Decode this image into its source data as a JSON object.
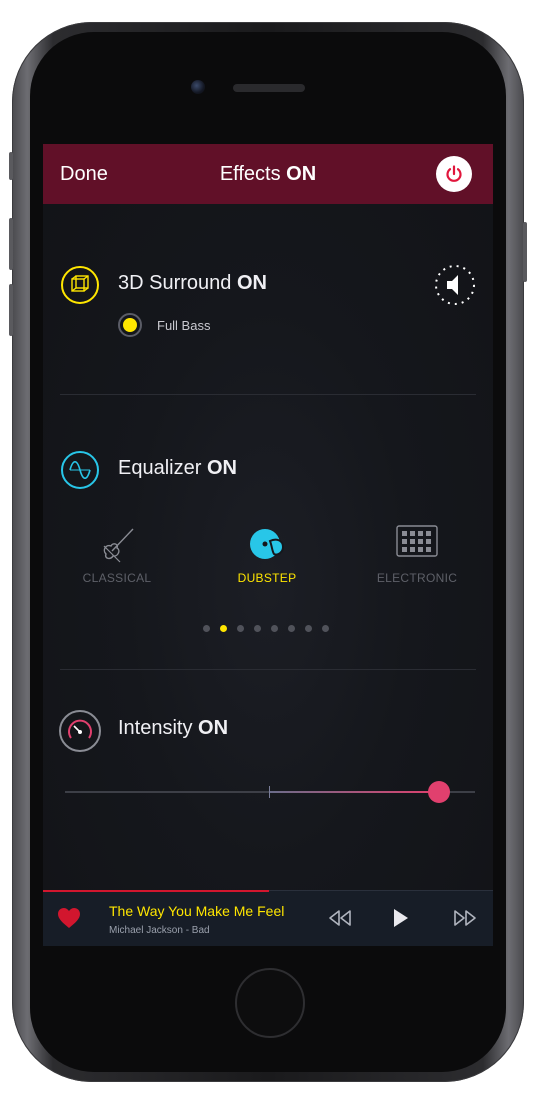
{
  "header": {
    "done_label": "Done",
    "title_prefix": "Effects ",
    "title_state": "ON"
  },
  "surround": {
    "label": "3D Surround ",
    "state": "ON",
    "option_label": "Full Bass"
  },
  "equalizer": {
    "label": "Equalizer ",
    "state": "ON",
    "presets": [
      {
        "label": "CLASSICAL",
        "active": false
      },
      {
        "label": "DUBSTEP",
        "active": true
      },
      {
        "label": "ELECTRONIC",
        "active": false
      }
    ],
    "page_count": 8,
    "active_page": 2
  },
  "intensity": {
    "label": "Intensity ",
    "state": "ON",
    "level": 0.91
  },
  "player": {
    "song_title": "The Way You Make Me Feel",
    "artist_album": "Michael Jackson - Bad",
    "progress": 0.5
  },
  "colors": {
    "header_bg": "#611028",
    "accent_yellow": "#ffe600",
    "accent_cyan": "#28c6e8",
    "accent_pink": "#e1406e",
    "heart_red": "#d2162e"
  },
  "icons": {
    "power": "power-icon",
    "surround": "cube-icon",
    "speaker": "speaker-icon",
    "equalizer": "sine-wave-icon",
    "intensity": "gauge-icon",
    "classical": "violin-icon",
    "dubstep": "dj-disc-icon",
    "electronic": "drum-pad-icon",
    "heart": "heart-icon",
    "rewind": "rewind-icon",
    "play": "play-icon",
    "forward": "fast-forward-icon"
  }
}
